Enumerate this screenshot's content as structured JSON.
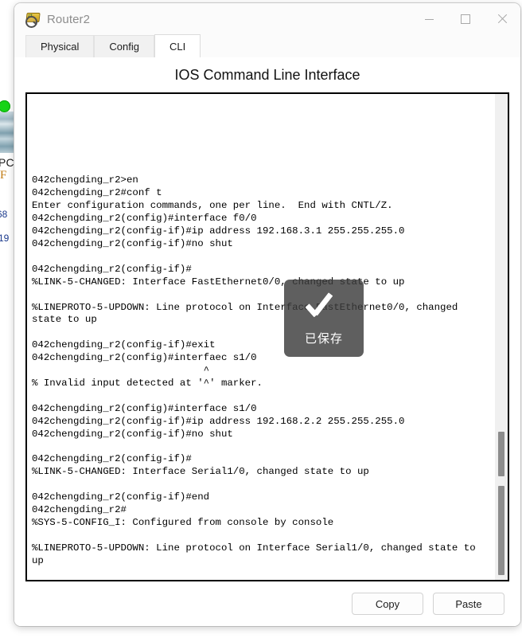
{
  "background": {
    "device_label": "PC",
    "interface_label": "F",
    "ip_fragment_1": "68",
    "ip_fragment_2": "19",
    "status_dot_color": "#16d316"
  },
  "window": {
    "title": "Router2",
    "icon": "router-magnifier-icon",
    "controls": {
      "minimize": "minimize-icon",
      "maximize": "maximize-icon",
      "close": "close-icon"
    }
  },
  "tabs": [
    {
      "label": "Physical",
      "active": false
    },
    {
      "label": "Config",
      "active": false
    },
    {
      "label": "CLI",
      "active": true
    }
  ],
  "cli": {
    "heading": "IOS Command Line Interface",
    "output": "\n\n\n\n\n\n042chengding_r2>en\n042chengding_r2#conf t\nEnter configuration commands, one per line.  End with CNTL/Z.\n042chengding_r2(config)#interface f0/0\n042chengding_r2(config-if)#ip address 192.168.3.1 255.255.255.0\n042chengding_r2(config-if)#no shut\n\n042chengding_r2(config-if)#\n%LINK-5-CHANGED: Interface FastEthernet0/0, changed state to up\n\n%LINEPROTO-5-UPDOWN: Line protocol on Interface FastEthernet0/0, changed state to up\n\n042chengding_r2(config-if)#exit\n042chengding_r2(config)#interfaec s1/0\n                             ^\n% Invalid input detected at '^' marker.\n\n042chengding_r2(config)#interface s1/0\n042chengding_r2(config-if)#ip address 192.168.2.2 255.255.255.0\n042chengding_r2(config-if)#no shut\n\n042chengding_r2(config-if)#\n%LINK-5-CHANGED: Interface Serial1/0, changed state to up\n\n042chengding_r2(config-if)#end\n042chengding_r2#\n%SYS-5-CONFIG_I: Configured from console by console\n\n%LINEPROTO-5-UPDOWN: Line protocol on Interface Serial1/0, changed state to up\n"
  },
  "toast": {
    "label": "已保存",
    "icon": "checkmark-icon",
    "background_color": "#3c3c3c"
  },
  "footer": {
    "copy_label": "Copy",
    "paste_label": "Paste"
  }
}
